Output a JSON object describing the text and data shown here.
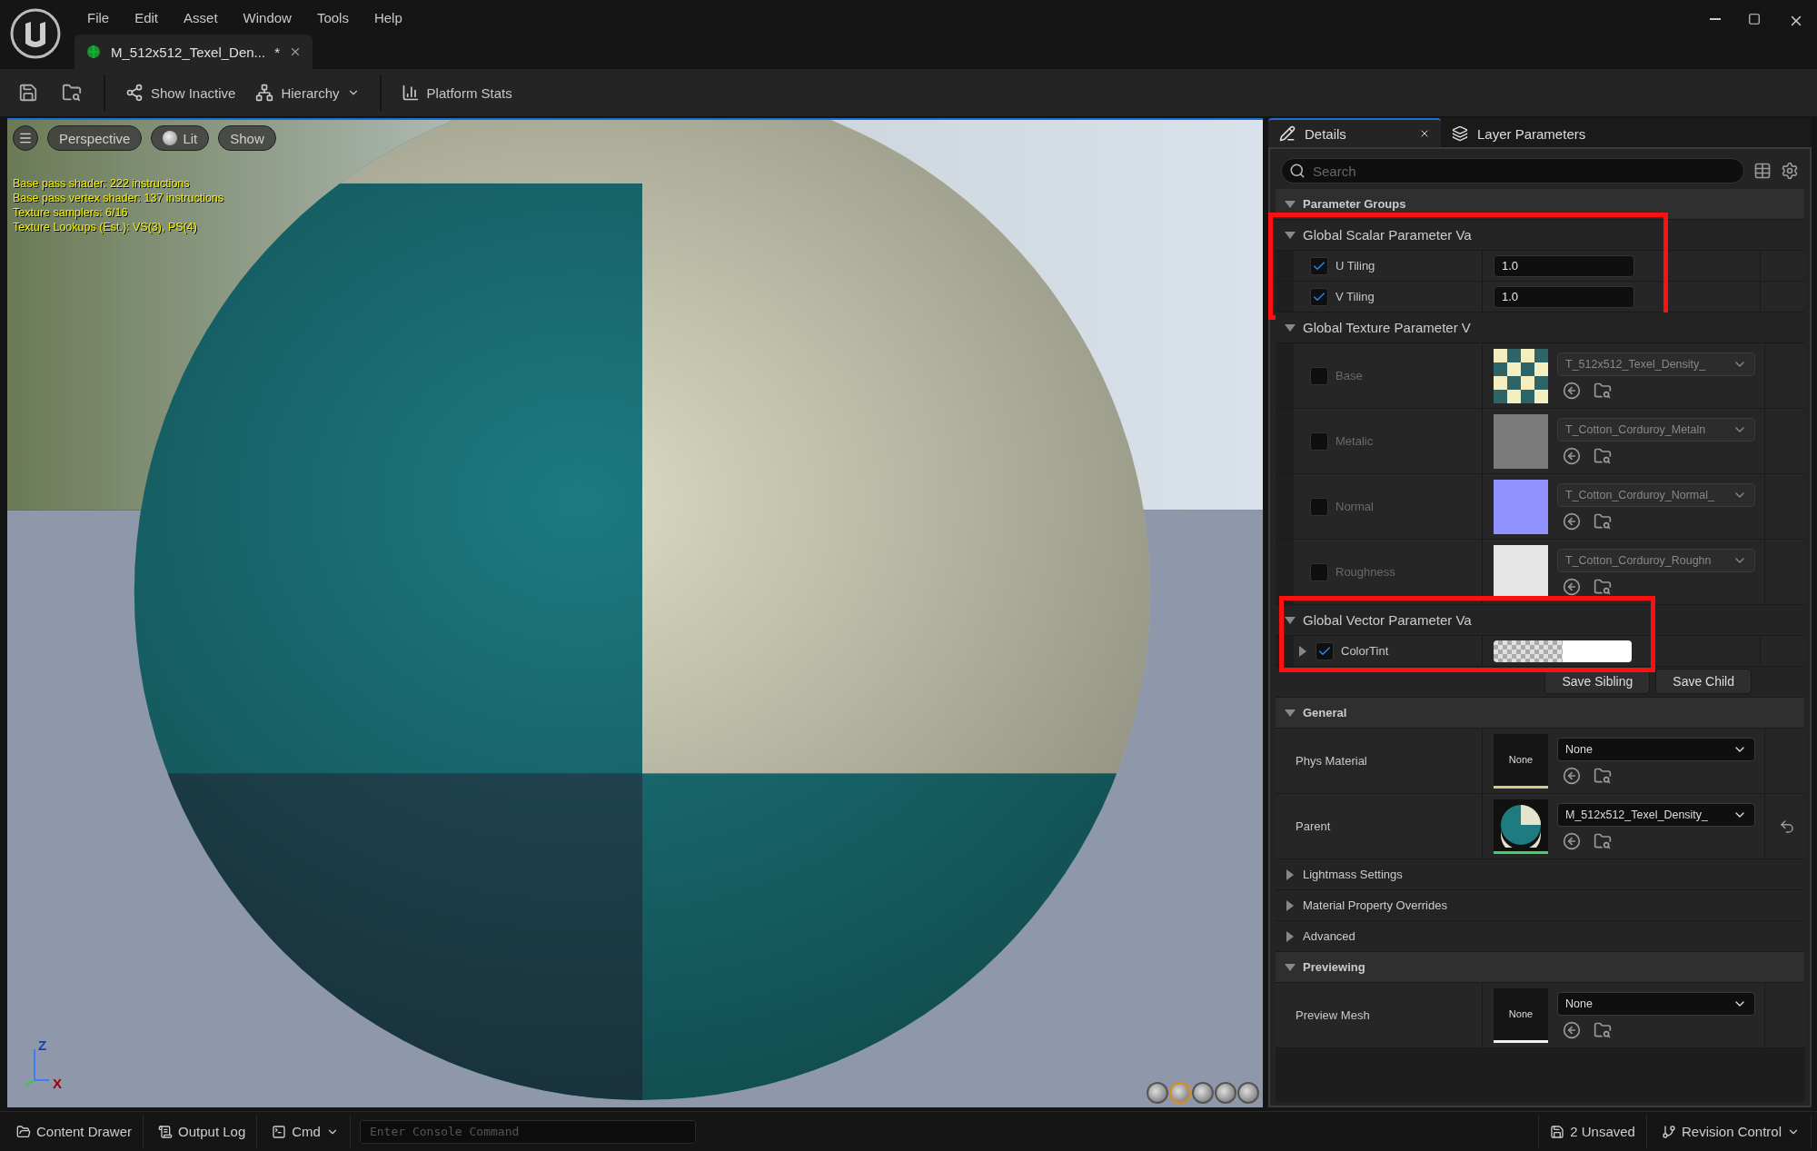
{
  "menu": [
    "File",
    "Edit",
    "Asset",
    "Window",
    "Tools",
    "Help"
  ],
  "document_tab": {
    "title": "M_512x512_Texel_Den...",
    "unsaved_mark": "*"
  },
  "toolbar": [
    {
      "kind": "button",
      "label": "Show Inactive"
    },
    {
      "kind": "dropdown",
      "label": "Hierarchy"
    },
    {
      "kind": "button",
      "label": "Platform Stats"
    }
  ],
  "viewport": {
    "buttons": [
      {
        "kind": "menu"
      },
      {
        "kind": "text",
        "label": "Perspective"
      },
      {
        "kind": "lit",
        "label": "Lit"
      },
      {
        "kind": "text",
        "label": "Show"
      }
    ],
    "stats": [
      "Base pass shader: 222 instructions",
      "Base pass vertex shader: 137 instructions",
      "Texture samplers: 6/16",
      "Texture Lookups (Est.): VS(3), PS(4)"
    ],
    "axis_labels": [
      "Z",
      "X"
    ],
    "preview_shapes": [
      {
        "selected": false
      },
      {
        "selected": true
      },
      {
        "selected": false
      },
      {
        "selected": false
      },
      {
        "selected": false
      }
    ]
  },
  "details": {
    "tabs": [
      {
        "label": "Details",
        "selected": true
      },
      {
        "label": "Layer Parameters",
        "selected": false
      }
    ],
    "search": {
      "placeholder": "Search"
    },
    "sections": [
      {
        "kind": "category",
        "title": "Parameter Groups",
        "expanded": true
      },
      {
        "kind": "group",
        "title": "Global Scalar Parameter Va",
        "expanded": true,
        "highlighted": true,
        "rows": [
          {
            "kind": "scalar",
            "label": "U Tiling",
            "checked": true,
            "value": "1.0"
          },
          {
            "kind": "scalar",
            "label": "V Tiling",
            "checked": true,
            "value": "1.0"
          }
        ]
      },
      {
        "kind": "group",
        "title": "Global Texture Parameter V",
        "expanded": true,
        "rows": [
          {
            "kind": "texture",
            "label": "Base",
            "checked": false,
            "checker": true,
            "color": "#2f6466",
            "asset": "T_512x512_Texel_Density_"
          },
          {
            "kind": "texture",
            "label": "Metalic",
            "checked": false,
            "color": "#7a7a7a",
            "asset": "T_Cotton_Corduroy_Metaln"
          },
          {
            "kind": "texture",
            "label": "Normal",
            "checked": false,
            "color": "#9090ff",
            "asset": "T_Cotton_Corduroy_Normal_"
          },
          {
            "kind": "texture",
            "label": "Roughness",
            "checked": false,
            "color": "#e6e6e6",
            "asset": "T_Cotton_Corduroy_Roughn"
          }
        ]
      },
      {
        "kind": "group",
        "title": "Global Vector Parameter Va",
        "expanded": true,
        "highlighted": true,
        "rows": [
          {
            "kind": "vector",
            "label": "ColorTint",
            "checked": true,
            "expanded": false
          }
        ]
      },
      {
        "kind": "buttons",
        "buttons": [
          "Save Sibling",
          "Save Child"
        ]
      },
      {
        "kind": "category",
        "title": "General",
        "expanded": true,
        "rows": [
          {
            "kind": "asset",
            "label": "Phys Material",
            "thumbnail": "None",
            "asset": "None",
            "color": "#d6c98c"
          },
          {
            "kind": "material",
            "label": "Parent",
            "asset": "M_512x512_Texel_Density_",
            "color": "#3fd16a",
            "resettable": true
          }
        ]
      },
      {
        "kind": "collapsed",
        "title": "Lightmass Settings",
        "expanded": false
      },
      {
        "kind": "collapsed",
        "title": "Material Property Overrides",
        "expanded": false
      },
      {
        "kind": "collapsed",
        "title": "Advanced",
        "expanded": false
      },
      {
        "kind": "category",
        "title": "Previewing",
        "expanded": true,
        "rows": [
          {
            "kind": "asset",
            "label": "Preview Mesh",
            "thumbnail": "None",
            "asset": "None",
            "color": "#f0f0f0"
          }
        ]
      }
    ]
  },
  "status_bar": {
    "left": [
      {
        "kind": "drawer",
        "label": "Content Drawer"
      },
      {
        "kind": "log",
        "label": "Output Log"
      },
      {
        "kind": "cmd",
        "label": "Cmd"
      }
    ],
    "console": {
      "placeholder": "Enter Console Command"
    },
    "unsaved": "2 Unsaved",
    "revision": "Revision Control"
  }
}
